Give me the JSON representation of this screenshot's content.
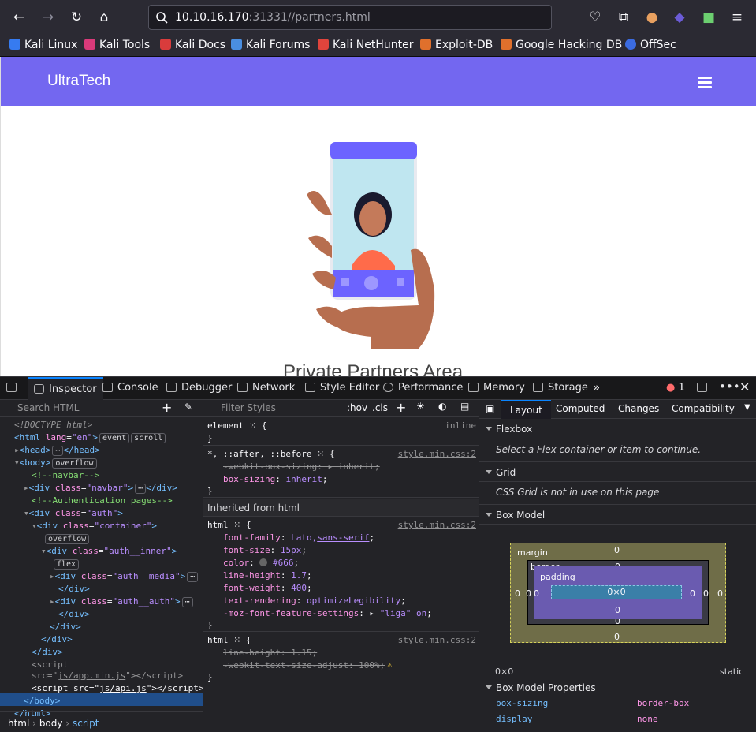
{
  "browser": {
    "url_host": "10.10.16.170",
    "url_rest": ":31331//partners.html",
    "bookmarks": [
      "Kali Linux",
      "Kali Tools",
      "Kali Docs",
      "Kali Forums",
      "Kali NetHunter",
      "Exploit-DB",
      "Google Hacking DB",
      "OffSec"
    ]
  },
  "page": {
    "brand": "UltraTech",
    "title": "Private Partners Area"
  },
  "devtools": {
    "tabs": [
      "Inspector",
      "Console",
      "Debugger",
      "Network",
      "Style Editor",
      "Performance",
      "Memory",
      "Storage"
    ],
    "error_count": "1",
    "search_html_placeholder": "Search HTML",
    "filter_styles_placeholder": "Filter Styles",
    "hov": ":hov",
    "cls": ".cls",
    "breadcrumbs": [
      "html",
      "body",
      "script"
    ],
    "layout_tabs": [
      "Layout",
      "Computed",
      "Changes",
      "Compatibility"
    ],
    "flexbox_title": "Flexbox",
    "flexbox_note": "Select a Flex container or item to continue.",
    "grid_title": "Grid",
    "grid_note": "CSS Grid is not in use on this page",
    "boxmodel_title": "Box Model",
    "boxmodel_labels": {
      "margin": "margin",
      "border": "border",
      "padding": "padding",
      "content": "0×0",
      "zero": "0"
    },
    "boxmodel_size": "0×0",
    "boxmodel_position": "static",
    "bmp_title": "Box Model Properties",
    "bmp": [
      {
        "name": "box-sizing",
        "value": "border-box"
      },
      {
        "name": "display",
        "value": "none"
      }
    ],
    "inherited_from": "Inherited from html",
    "style_source": "style.min.css:2",
    "inline": "inline"
  }
}
